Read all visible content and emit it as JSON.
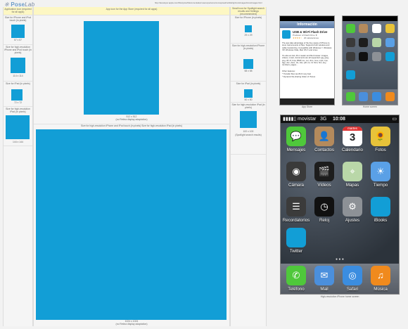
{
  "logo": {
    "mark": "※",
    "name_a": "Pose",
    "name_b": "Lab"
  },
  "url": "http://developer.apple.com/library/ios/#documentation/userexperience/conceptual/mobilehig/IconsImages/IconsImages.html",
  "left_col": {
    "header": "Application icon (required for all apps)",
    "items": [
      {
        "title": "Size for iPhone and iPod touch (in pixels)",
        "size": "57 x 57"
      },
      {
        "title": "Size for high-resolution iPhone and iPod touch (in pixels)",
        "size": "114 x 114"
      },
      {
        "title": "Size for iPad (in pixels)",
        "size": "72 x 72"
      },
      {
        "title": "Size for high-resolution iPad (in pixels)",
        "size": "144 x 144"
      }
    ]
  },
  "mid_col": {
    "header": "App icon for the App Store (required for all apps)",
    "size_512": "512 x 512",
    "size_512_note": "(no Retina display adaptation)",
    "header2": "Size for high-resolution iPhone and iPod touch (in pixels) Size for high-resolution iPad (in pixels)",
    "size_1024": "1024 x 1024",
    "size_1024_note": "(no Retina display adaptation)"
  },
  "right_col": {
    "header": "Small icon for Spotlight search results and Settings (recommended)",
    "items": [
      {
        "title": "Size for iPhone (in pixels)",
        "size": "29 x 29"
      },
      {
        "title": "Size for high-resolution iPhone (in pixels)",
        "size": "58 x 58"
      },
      {
        "title": "Size for iPad (in pixels)",
        "size": "50 x 50"
      },
      {
        "title": "Size for high-resolution iPad (in pixels)",
        "size": "100 x 100"
      }
    ],
    "spotlight_note": "(Spotlight search results)"
  },
  "appstore_phone": {
    "nav_title": "Información",
    "app_name": "USB & Wi-Fi Flash Drive",
    "publisher": "Producer of Flash Drive ★",
    "rating": "★★★★☆",
    "ratings_count": "20 valoraciones",
    "desc1": "The app take advantage of the free space of iPhone to store real amounts of files. Supports both wireless and cable transferring. Compatible with Windows 7, Windows XP, Windows Vista, Mac OS X and Linux.",
    "desc2": "It's also an ALL-IN-1 reader and file browser: images, videos, music, documents are all supported: jpg, jpeg, png, tiff, tif, bmp, BMP, ico, cur, xbm, mov, mp4, mpv, 3gp, doc, docx, xls, xlsx, pdf, txt, rtf, html, htm, key, numbers, pages...",
    "desc3": "Other features:",
    "feature1": "* Transfer files via Wi-Fi very fast",
    "feature2": "* Dynamic file-sharing folder of iTunes",
    "caption": "App Store"
  },
  "home_small": {
    "caption": "Home screen"
  },
  "main_phone": {
    "carrier": "movistar",
    "network": "3G",
    "time": "10:08",
    "calendar_day": "martes",
    "calendar_num": "3",
    "apps": [
      {
        "label": "Mensajes",
        "icon": "messages-icon",
        "color": "#4fc83b"
      },
      {
        "label": "Contactos",
        "icon": "contacts-icon",
        "color": "#b48a5c"
      },
      {
        "label": "Calendario",
        "icon": "calendar-icon",
        "color": "#ffffff"
      },
      {
        "label": "Fotos",
        "icon": "photos-icon",
        "color": "#e8c33a"
      },
      {
        "label": "Cámara",
        "icon": "camera-icon",
        "color": "#3a3a3a"
      },
      {
        "label": "Vídeos",
        "icon": "videos-icon",
        "color": "#1d1d1d"
      },
      {
        "label": "Mapas",
        "icon": "maps-icon",
        "color": "#b9d7a8"
      },
      {
        "label": "Tiempo",
        "icon": "weather-icon",
        "color": "#5aa0e6"
      },
      {
        "label": "Recordatorios",
        "icon": "reminders-icon",
        "color": "#3b3b3b"
      },
      {
        "label": "Reloj",
        "icon": "clock-icon",
        "color": "#111111"
      },
      {
        "label": "Ajustes",
        "icon": "settings-icon",
        "color": "#8d9196"
      },
      {
        "label": "iBooks",
        "icon": "ibooks-icon",
        "color": "#129ed6"
      },
      {
        "label": "Twitter",
        "icon": "twitter-icon",
        "color": "#129ed6"
      }
    ],
    "dock": [
      {
        "label": "Teléfono",
        "icon": "phone-icon",
        "color": "#4fc83b"
      },
      {
        "label": "Mail",
        "icon": "mail-icon",
        "color": "#4b8fdc"
      },
      {
        "label": "Safari",
        "icon": "safari-icon",
        "color": "#3b8de0"
      },
      {
        "label": "Música",
        "icon": "music-icon",
        "color": "#f08a1d"
      }
    ],
    "caption": "High-resolution iPhone home screen"
  },
  "colors": {
    "icon_blue": "#129ed6",
    "highlight": "#fdf7c3"
  }
}
